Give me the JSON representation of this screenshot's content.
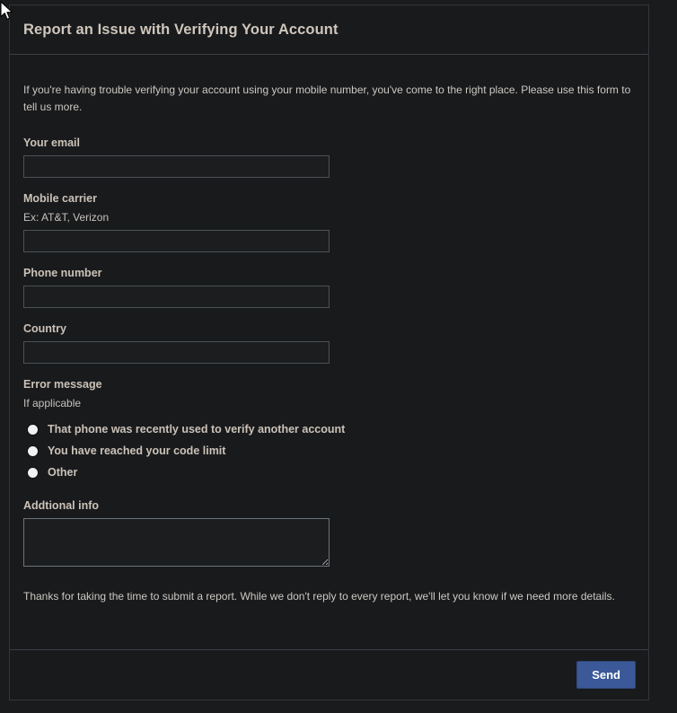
{
  "dialog": {
    "title": "Report an Issue with Verifying Your Account",
    "intro": "If you're having trouble verifying your account using your mobile number, you've come to the right place. Please use this form to tell us more.",
    "thanks": "Thanks for taking the time to submit a report. While we don't reply to every report, we'll let you know if we need more details.",
    "accent_color": "#3b5998",
    "background_color": "#191a1c",
    "text_color": "#cbc2b8"
  },
  "fields": {
    "email": {
      "label": "Your email",
      "value": "",
      "placeholder": ""
    },
    "carrier": {
      "label": "Mobile carrier",
      "hint": "Ex: AT&T, Verizon",
      "value": "",
      "placeholder": ""
    },
    "phone": {
      "label": "Phone number",
      "value": "",
      "placeholder": ""
    },
    "country": {
      "label": "Country",
      "value": "",
      "placeholder": ""
    },
    "additional": {
      "label": "Addtional info",
      "value": "",
      "placeholder": ""
    }
  },
  "error_message": {
    "label": "Error message",
    "hint": "If applicable",
    "options": [
      {
        "label": "That phone was recently used to verify another account",
        "selected": false
      },
      {
        "label": "You have reached your code limit",
        "selected": false
      },
      {
        "label": "Other",
        "selected": false
      }
    ]
  },
  "footer": {
    "send_label": "Send"
  },
  "cursor": {
    "icon": "arrow-pointer-icon"
  }
}
